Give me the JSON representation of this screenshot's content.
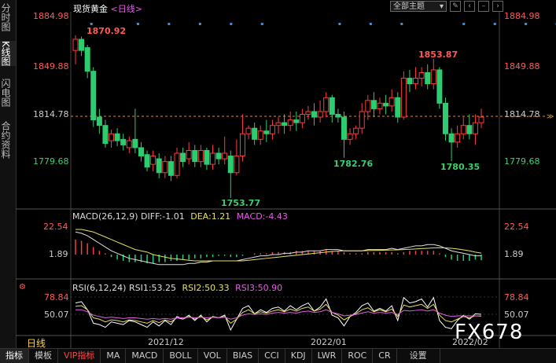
{
  "sidebar": {
    "tabs": [
      {
        "label": "分时图",
        "active": false
      },
      {
        "label": "K线图",
        "active": true
      },
      {
        "label": "闪电图",
        "active": false
      },
      {
        "label": "合约资料",
        "active": false
      }
    ]
  },
  "header": {
    "title": "现货黄金",
    "period": "<日线>",
    "theme_select": "全部主题"
  },
  "price_axis": {
    "ticks": [
      "1884.98",
      "1849.88",
      "1814.78",
      "1779.68"
    ],
    "current": "1814.78"
  },
  "annotations": {
    "high1": "1870.92",
    "high2": "1853.87",
    "low1": "1753.77",
    "low2": "1782.76",
    "low3": "1780.35"
  },
  "macd": {
    "title": "MACD(26,12,9)",
    "diff": "DIFF:-1.01",
    "dea": "DEA:1.21",
    "macd": "MACD:-4.43",
    "ticks": [
      "22.54",
      "1.89"
    ]
  },
  "rsi": {
    "title": "RSI(6,12,24)",
    "rsi1": "RSI1:53.25",
    "rsi2": "RSI2:50.33",
    "rsi3": "RSI3:50.90",
    "ticks": [
      "78.84",
      "50.07"
    ]
  },
  "time_axis": {
    "period_label": "日线",
    "dates": [
      "2021/12",
      "2022/01",
      "2022/02"
    ]
  },
  "watermark": "FX678",
  "bottom_tabs": [
    {
      "label": "指标",
      "active": true,
      "vip": false
    },
    {
      "label": "模板",
      "active": false,
      "vip": false
    },
    {
      "label": "VIP指标",
      "active": false,
      "vip": true
    },
    {
      "label": "MA",
      "active": false,
      "vip": false
    },
    {
      "label": "MACD",
      "active": false,
      "vip": false
    },
    {
      "label": "BOLL",
      "active": false,
      "vip": false
    },
    {
      "label": "VOL",
      "active": false,
      "vip": false
    },
    {
      "label": "BIAS",
      "active": false,
      "vip": false
    },
    {
      "label": "CCI",
      "active": false,
      "vip": false
    },
    {
      "label": "KDJ",
      "active": false,
      "vip": false
    },
    {
      "label": "LWR",
      "active": false,
      "vip": false
    },
    {
      "label": "ROC",
      "active": false,
      "vip": false
    },
    {
      "label": "CR",
      "active": false,
      "vip": false
    },
    {
      "label": "设置",
      "active": false,
      "vip": false
    }
  ],
  "colors": {
    "up": "#ff3b3b",
    "down": "#2ecc71",
    "diff": "#e0e0e0",
    "dea": "#e8e060",
    "macd_label": "#e060e0",
    "rsi1": "#ffffff",
    "rsi2": "#e8e060",
    "rsi3": "#e060e0"
  },
  "chart_data": {
    "type": "candlestick",
    "ylim": [
      1753.77,
      1884.98
    ],
    "candles": [
      [
        1860,
        1868,
        1850,
        1870.92
      ],
      [
        1868,
        1860,
        1856,
        1870
      ],
      [
        1862,
        1845,
        1840,
        1864
      ],
      [
        1845,
        1810,
        1805,
        1848
      ],
      [
        1812,
        1806,
        1800,
        1818
      ],
      [
        1806,
        1793,
        1790,
        1810
      ],
      [
        1795,
        1800,
        1790,
        1803
      ],
      [
        1800,
        1795,
        1791,
        1804
      ],
      [
        1796,
        1792,
        1788,
        1800
      ],
      [
        1790,
        1795,
        1786,
        1798
      ],
      [
        1796,
        1790,
        1786,
        1818
      ],
      [
        1790,
        1784,
        1780,
        1794
      ],
      [
        1785,
        1776,
        1773,
        1788
      ],
      [
        1778,
        1784,
        1773,
        1788
      ],
      [
        1782,
        1772,
        1768,
        1786
      ],
      [
        1772,
        1780,
        1768,
        1784
      ],
      [
        1780,
        1770,
        1766,
        1784
      ],
      [
        1770,
        1786,
        1768,
        1790
      ],
      [
        1786,
        1780,
        1776,
        1790
      ],
      [
        1782,
        1788,
        1778,
        1794
      ],
      [
        1788,
        1780,
        1776,
        1792
      ],
      [
        1780,
        1788,
        1776,
        1792
      ],
      [
        1788,
        1778,
        1774,
        1790
      ],
      [
        1778,
        1786,
        1774,
        1792
      ],
      [
        1786,
        1782,
        1778,
        1790
      ],
      [
        1782,
        1786,
        1778,
        1798
      ],
      [
        1784,
        1772,
        1753.77,
        1788
      ],
      [
        1772,
        1784,
        1770,
        1796
      ],
      [
        1784,
        1800,
        1780,
        1814
      ],
      [
        1800,
        1804,
        1796,
        1806
      ],
      [
        1804,
        1796,
        1792,
        1808
      ],
      [
        1796,
        1802,
        1792,
        1806
      ],
      [
        1802,
        1800,
        1794,
        1810
      ],
      [
        1800,
        1806,
        1796,
        1810
      ],
      [
        1806,
        1808,
        1800,
        1812
      ],
      [
        1808,
        1806,
        1800,
        1814
      ],
      [
        1806,
        1810,
        1802,
        1816
      ],
      [
        1810,
        1808,
        1802,
        1816
      ],
      [
        1808,
        1814,
        1804,
        1818
      ],
      [
        1814,
        1816,
        1810,
        1820
      ],
      [
        1816,
        1812,
        1806,
        1822
      ],
      [
        1812,
        1816,
        1808,
        1824
      ],
      [
        1816,
        1826,
        1812,
        1830
      ],
      [
        1826,
        1814,
        1808,
        1828
      ],
      [
        1814,
        1812,
        1808,
        1818
      ],
      [
        1812,
        1796,
        1782.76,
        1816
      ],
      [
        1796,
        1800,
        1792,
        1804
      ],
      [
        1800,
        1804,
        1796,
        1806
      ],
      [
        1804,
        1816,
        1800,
        1822
      ],
      [
        1816,
        1824,
        1810,
        1828
      ],
      [
        1824,
        1818,
        1812,
        1830
      ],
      [
        1818,
        1822,
        1814,
        1826
      ],
      [
        1822,
        1820,
        1814,
        1828
      ],
      [
        1820,
        1826,
        1816,
        1832
      ],
      [
        1826,
        1812,
        1808,
        1830
      ],
      [
        1812,
        1840,
        1810,
        1845
      ],
      [
        1840,
        1836,
        1830,
        1846
      ],
      [
        1836,
        1840,
        1832,
        1848
      ],
      [
        1840,
        1844,
        1834,
        1848
      ],
      [
        1844,
        1836,
        1832,
        1850
      ],
      [
        1836,
        1846,
        1832,
        1853.87
      ],
      [
        1846,
        1822,
        1818,
        1848
      ],
      [
        1822,
        1800,
        1795,
        1826
      ],
      [
        1800,
        1794,
        1780.35,
        1804
      ],
      [
        1794,
        1800,
        1790,
        1806
      ],
      [
        1800,
        1806,
        1796,
        1812
      ],
      [
        1806,
        1800,
        1796,
        1814
      ],
      [
        1800,
        1808,
        1792,
        1814
      ],
      [
        1808,
        1812,
        1804,
        1818
      ]
    ],
    "macd_hist": [
      12,
      11,
      9,
      6,
      3,
      1,
      -2,
      -4,
      -5,
      -6,
      -6,
      -6,
      -7,
      -7,
      -6,
      -6,
      -5,
      -5,
      -4,
      -4,
      -3,
      -3,
      -2,
      -2,
      -1,
      -1,
      -2,
      -2,
      -1,
      0,
      1,
      1,
      1,
      2,
      2,
      2,
      2,
      3,
      3,
      3,
      3,
      3,
      4,
      3,
      3,
      2,
      1,
      1,
      1,
      2,
      2,
      2,
      2,
      2,
      1,
      2,
      3,
      3,
      3,
      3,
      3,
      1,
      -2,
      -4,
      -5,
      -5,
      -5,
      -4,
      -4.43
    ],
    "diff": [
      18,
      17,
      15,
      12,
      9,
      6,
      3,
      1,
      -1,
      -3,
      -4,
      -5,
      -6,
      -7,
      -8,
      -8,
      -8,
      -8,
      -8,
      -7,
      -7,
      -6,
      -6,
      -5,
      -5,
      -5,
      -5,
      -5,
      -4,
      -3,
      -2,
      -1,
      -1,
      0,
      0,
      1,
      1,
      2,
      2,
      3,
      3,
      3,
      4,
      4,
      4,
      3,
      3,
      3,
      3,
      4,
      4,
      4,
      4,
      5,
      4,
      5,
      6,
      7,
      7,
      8,
      8,
      7,
      5,
      3,
      2,
      1,
      0,
      -1,
      -1.01
    ],
    "dea": [
      20,
      20,
      19,
      18,
      16,
      14,
      12,
      10,
      8,
      6,
      4,
      3,
      2,
      0,
      -1,
      -2,
      -3,
      -3.5,
      -4,
      -4.5,
      -5,
      -5,
      -5,
      -5,
      -5,
      -5,
      -5,
      -5,
      -5,
      -4.5,
      -4,
      -3.5,
      -3,
      -2.5,
      -2,
      -1.5,
      -1,
      -0.5,
      0,
      0.5,
      1,
      1.5,
      2,
      2.5,
      2.8,
      3,
      3,
      3,
      3,
      3.2,
      3.3,
      3.4,
      3.5,
      3.7,
      3.8,
      4,
      4.2,
      4.5,
      4.8,
      5,
      5.3,
      5.5,
      5.3,
      5,
      4.5,
      3.8,
      3,
      2,
      1.21
    ],
    "rsi1": [
      70,
      72,
      60,
      40,
      38,
      34,
      42,
      40,
      38,
      44,
      42,
      38,
      34,
      42,
      36,
      44,
      38,
      50,
      46,
      52,
      44,
      52,
      42,
      50,
      48,
      52,
      30,
      46,
      62,
      66,
      54,
      60,
      56,
      62,
      64,
      58,
      66,
      60,
      66,
      70,
      58,
      64,
      76,
      52,
      48,
      36,
      50,
      56,
      66,
      70,
      58,
      62,
      58,
      66,
      44,
      78,
      70,
      72,
      76,
      64,
      78,
      44,
      34,
      32,
      44,
      52,
      46,
      54,
      53.25
    ],
    "rsi2": [
      65,
      66,
      60,
      48,
      46,
      42,
      45,
      44,
      42,
      45,
      44,
      42,
      40,
      44,
      41,
      45,
      42,
      48,
      46,
      50,
      46,
      50,
      45,
      49,
      48,
      50,
      40,
      46,
      56,
      60,
      54,
      57,
      55,
      58,
      60,
      57,
      61,
      58,
      62,
      64,
      58,
      61,
      68,
      56,
      52,
      45,
      50,
      54,
      60,
      63,
      57,
      60,
      57,
      61,
      50,
      67,
      64,
      66,
      68,
      62,
      68,
      52,
      44,
      42,
      46,
      50,
      48,
      51,
      50.33
    ],
    "rsi3": [
      60,
      60,
      57,
      52,
      50,
      48,
      49,
      48,
      47,
      48,
      48,
      47,
      46,
      47,
      46,
      47,
      46,
      48,
      48,
      49,
      48,
      49,
      48,
      49,
      48,
      49,
      46,
      48,
      52,
      54,
      53,
      54,
      53,
      55,
      56,
      55,
      56,
      55,
      57,
      58,
      56,
      57,
      60,
      56,
      54,
      51,
      52,
      53,
      55,
      57,
      55,
      56,
      55,
      56,
      53,
      59,
      58,
      59,
      60,
      58,
      60,
      55,
      52,
      50,
      51,
      51,
      51,
      51,
      50.9
    ]
  }
}
